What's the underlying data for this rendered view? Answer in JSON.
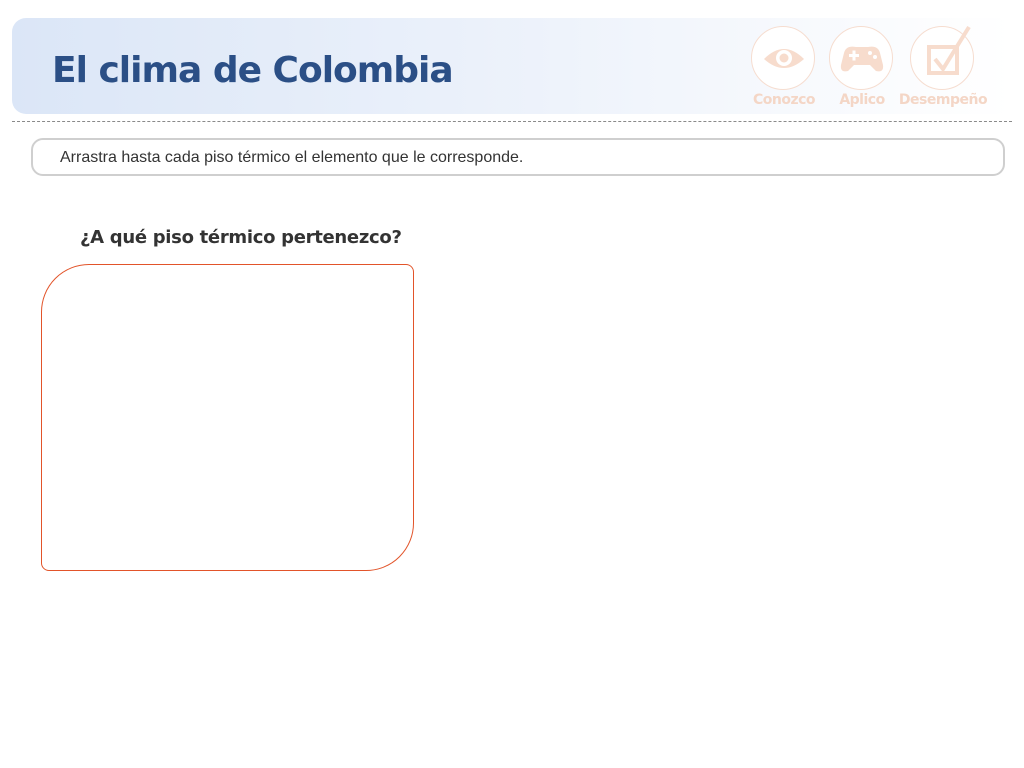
{
  "header": {
    "title": "El clima de Colombia",
    "nav": [
      {
        "label": "Conozco",
        "icon": "eye-icon"
      },
      {
        "label": "Aplico",
        "icon": "gamepad-icon"
      },
      {
        "label": "Desempeño",
        "icon": "checkbox-icon"
      }
    ]
  },
  "instruction": {
    "text": "Arrastra hasta cada piso térmico el elemento que le corresponde."
  },
  "activity": {
    "question": "¿A qué piso térmico pertenezco?"
  },
  "colors": {
    "title": "#2b4f86",
    "accent": "#e2542a",
    "nav_faded": "#f4d6c6"
  }
}
